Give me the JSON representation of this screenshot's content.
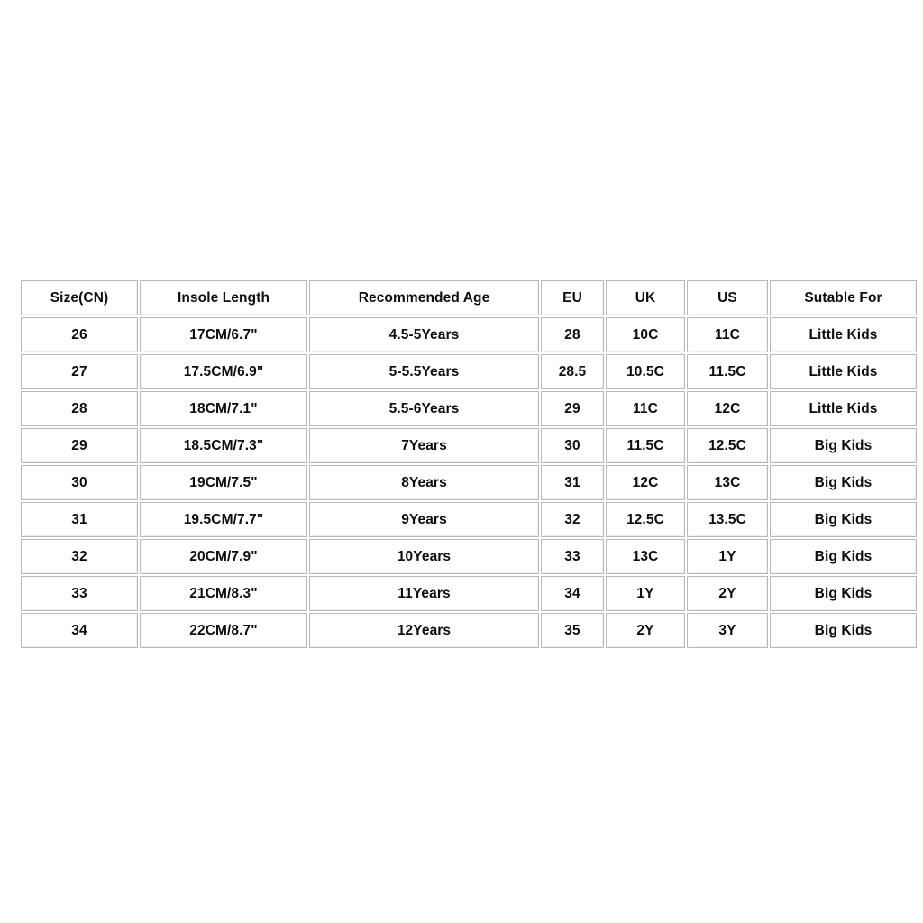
{
  "table": {
    "columns": [
      "Size(CN)",
      "Insole Length",
      "Recommended Age",
      "EU",
      "UK",
      "US",
      "Sutable For"
    ],
    "rows": [
      [
        "26",
        "17CM/6.7\"",
        "4.5-5Years",
        "28",
        "10C",
        "11C",
        "Little Kids"
      ],
      [
        "27",
        "17.5CM/6.9\"",
        "5-5.5Years",
        "28.5",
        "10.5C",
        "11.5C",
        "Little Kids"
      ],
      [
        "28",
        "18CM/7.1\"",
        "5.5-6Years",
        "29",
        "11C",
        "12C",
        "Little Kids"
      ],
      [
        "29",
        "18.5CM/7.3\"",
        "7Years",
        "30",
        "11.5C",
        "12.5C",
        "Big Kids"
      ],
      [
        "30",
        "19CM/7.5\"",
        "8Years",
        "31",
        "12C",
        "13C",
        "Big Kids"
      ],
      [
        "31",
        "19.5CM/7.7\"",
        "9Years",
        "32",
        "12.5C",
        "13.5C",
        "Big Kids"
      ],
      [
        "32",
        "20CM/7.9\"",
        "10Years",
        "33",
        "13C",
        "1Y",
        "Big Kids"
      ],
      [
        "33",
        "21CM/8.3\"",
        "11Years",
        "34",
        "1Y",
        "2Y",
        "Big Kids"
      ],
      [
        "34",
        "22CM/8.7\"",
        "12Years",
        "35",
        "2Y",
        "3Y",
        "Big Kids"
      ]
    ]
  },
  "colors": {
    "background": "#ffffff",
    "cell_background": "#ffffff",
    "border": "#b9b9b9",
    "text": "#0d0d0d"
  }
}
